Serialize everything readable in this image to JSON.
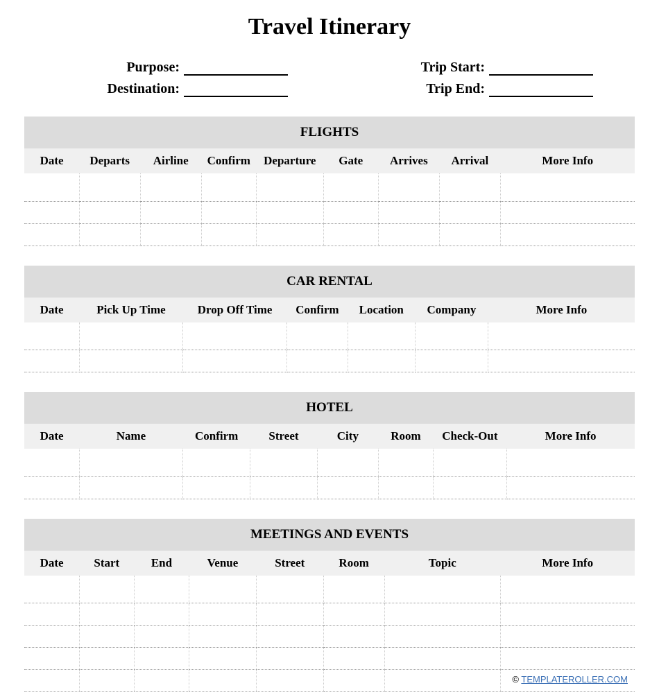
{
  "title": "Travel Itinerary",
  "meta": {
    "purpose_label": "Purpose:",
    "destination_label": "Destination:",
    "trip_start_label": "Trip Start:",
    "trip_end_label": "Trip End:",
    "purpose": "",
    "destination": "",
    "trip_start": "",
    "trip_end": ""
  },
  "sections": {
    "flights": {
      "title": "FLIGHTS",
      "columns": [
        "Date",
        "Departs",
        "Airline",
        "Confirm",
        "Departure",
        "Gate",
        "Arrives",
        "Arrival",
        "More Info"
      ],
      "rows": 3
    },
    "car_rental": {
      "title": "CAR RENTAL",
      "columns": [
        "Date",
        "Pick Up Time",
        "Drop Off Time",
        "Confirm",
        "Location",
        "Company",
        "More Info"
      ],
      "rows": 2
    },
    "hotel": {
      "title": "HOTEL",
      "columns": [
        "Date",
        "Name",
        "Confirm",
        "Street",
        "City",
        "Room",
        "Check-Out",
        "More Info"
      ],
      "rows": 2
    },
    "meetings": {
      "title": "MEETINGS AND EVENTS",
      "columns": [
        "Date",
        "Start",
        "End",
        "Venue",
        "Street",
        "Room",
        "Topic",
        "More Info"
      ],
      "rows": 5
    }
  },
  "footer": {
    "copyright": "©",
    "link_text": "TEMPLATEROLLER.COM"
  }
}
